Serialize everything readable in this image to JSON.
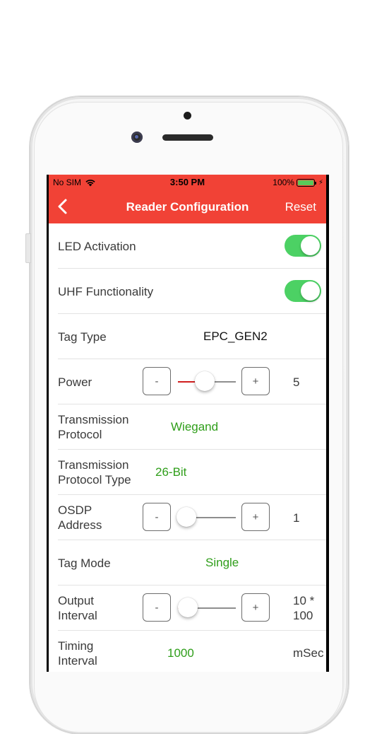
{
  "status_bar": {
    "carrier": "No SIM",
    "time": "3:50 PM",
    "battery_percent": "100%",
    "battery_level": 1.0
  },
  "nav_bar": {
    "back_icon": "chevron-left-icon",
    "title": "Reader Configuration",
    "reset_label": "Reset"
  },
  "colors": {
    "accent": "#f14236",
    "toggle_on": "#4cd164",
    "value_green": "#2f9e1a"
  },
  "settings": {
    "led_activation": {
      "label": "LED Activation",
      "enabled": true
    },
    "uhf_functionality": {
      "label": "UHF Functionality",
      "enabled": true
    },
    "tag_type": {
      "label": "Tag Type",
      "value": "EPC_GEN2"
    },
    "power": {
      "label": "Power",
      "minus": "-",
      "plus": "+",
      "value": "5",
      "slider_fraction": 0.45
    },
    "transmission_protocol": {
      "label": "Transmission Protocol",
      "value": "Wiegand"
    },
    "transmission_protocol_type": {
      "label": "Transmission Protocol Type",
      "value": "26-Bit"
    },
    "osdp_address": {
      "label": "OSDP Address",
      "minus": "-",
      "plus": "+",
      "value": "1",
      "slider_fraction": 0.0
    },
    "tag_mode": {
      "label": "Tag Mode",
      "value": "Single"
    },
    "output_interval": {
      "label": "Output Interval",
      "minus": "-",
      "plus": "+",
      "value": "10 * 100",
      "slider_fraction": 0.03
    },
    "timing_interval": {
      "label": "Timing Interval",
      "value": "1000",
      "unit": "mSec"
    }
  }
}
